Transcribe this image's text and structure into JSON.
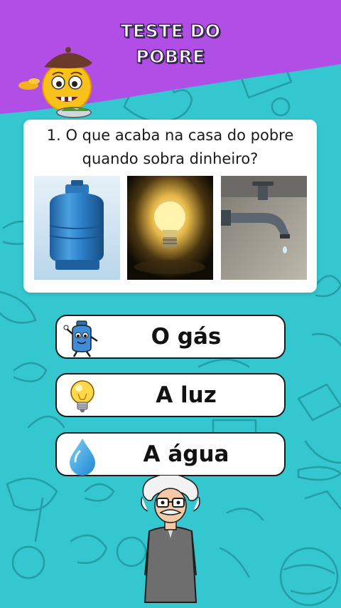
{
  "header": {
    "title_line1": "TESTE DO",
    "title_line2": "POBRE",
    "background_color": "#b14ee6"
  },
  "background_color": "#34c7cf",
  "question": {
    "text": "1. O que acaba na casa do pobre quando sobra dinheiro?",
    "images": [
      {
        "name": "gas-cylinder-image"
      },
      {
        "name": "light-bulb-image"
      },
      {
        "name": "water-tap-image"
      }
    ]
  },
  "answers": [
    {
      "label": "O gás",
      "icon": "gas-cylinder-mascot-icon"
    },
    {
      "label": "A luz",
      "icon": "light-bulb-icon"
    },
    {
      "label": "A água",
      "icon": "water-drop-icon"
    }
  ]
}
